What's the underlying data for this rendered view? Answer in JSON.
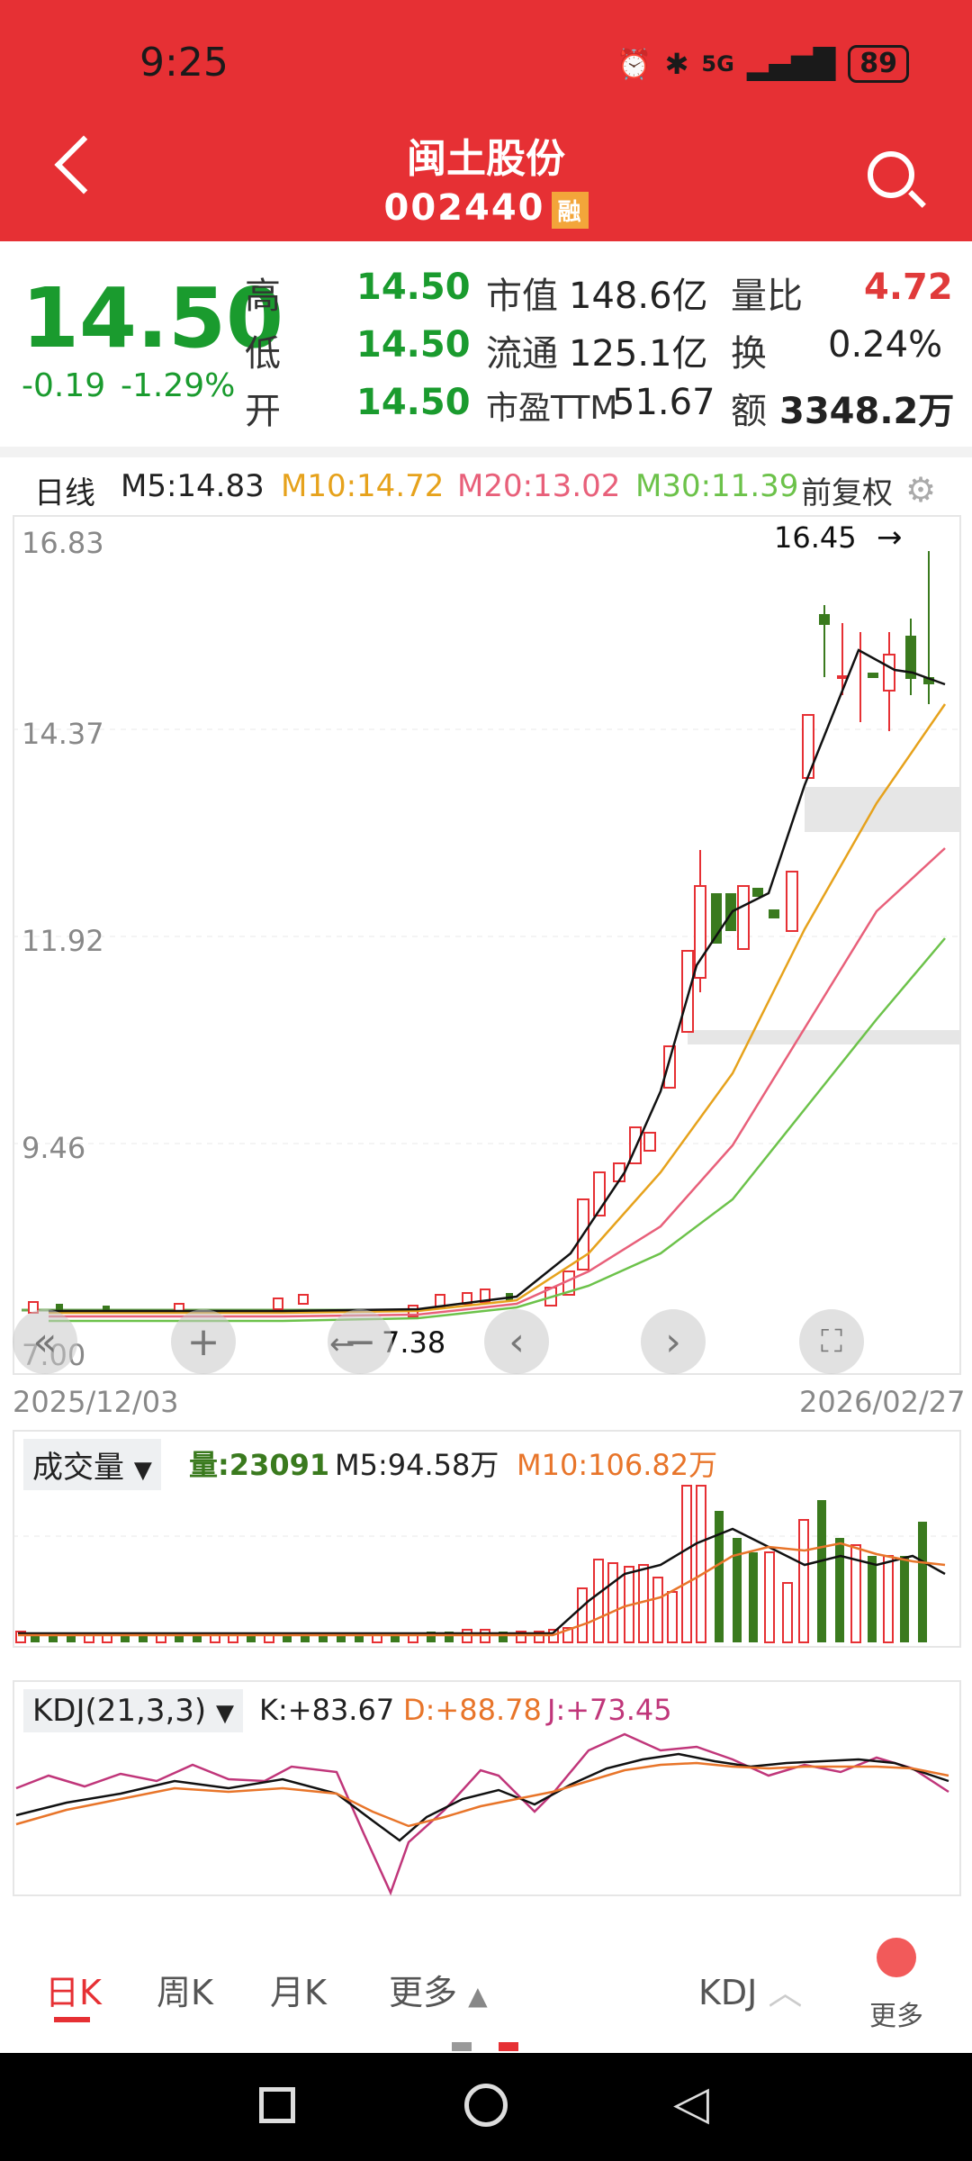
{
  "status": {
    "time": "9:25",
    "battery": "89",
    "signal": "5G"
  },
  "header": {
    "name": "闽土股份",
    "code": "002440",
    "badge": "融"
  },
  "quote": {
    "price": "14.50",
    "change": "-0.19",
    "change_pct": "-1.29%",
    "high_label": "高",
    "high": "14.50",
    "low_label": "低",
    "low": "14.50",
    "open_label": "开",
    "open": "14.50",
    "mcap_label": "市值",
    "mcap": "148.6亿",
    "float_label": "流通",
    "float": "125.1亿",
    "pe_label": "市盈TTM",
    "pe": "51.67",
    "vr_label": "量比",
    "vr": "4.72",
    "turn_label": "换",
    "turn": "0.24%",
    "amt_label": "额",
    "amt": "3348.2万"
  },
  "ma_bar": {
    "period": "日线",
    "m5": "M5:14.83",
    "m10": "M10:14.72",
    "m20": "M20:13.02",
    "m30": "M30:11.39",
    "adj": "前复权"
  },
  "kline": {
    "y_ticks": [
      "16.83",
      "14.37",
      "11.92",
      "9.46",
      "7.00"
    ],
    "max_mark": "16.45",
    "min_mark": "7.38",
    "date_start": "2025/12/03",
    "date_end": "2026/02/27"
  },
  "volume": {
    "selector": "成交量",
    "vol": "量:23091",
    "m5": "M5:94.58万",
    "m10": "M10:106.82万"
  },
  "kdj": {
    "selector": "KDJ(21,3,3)",
    "k": "K:+83.67",
    "d": "D:+88.78",
    "j": "J:+73.45"
  },
  "tabs": {
    "day": "日K",
    "week": "周K",
    "month": "月K",
    "more": "更多",
    "indicator": "KDJ",
    "more2": "更多"
  },
  "colors": {
    "red": "#e63034",
    "green": "#1a9b2e",
    "ma5": "#111111",
    "ma10": "#e6a21c",
    "ma20": "#e8607a",
    "ma30": "#6cc24a"
  }
}
